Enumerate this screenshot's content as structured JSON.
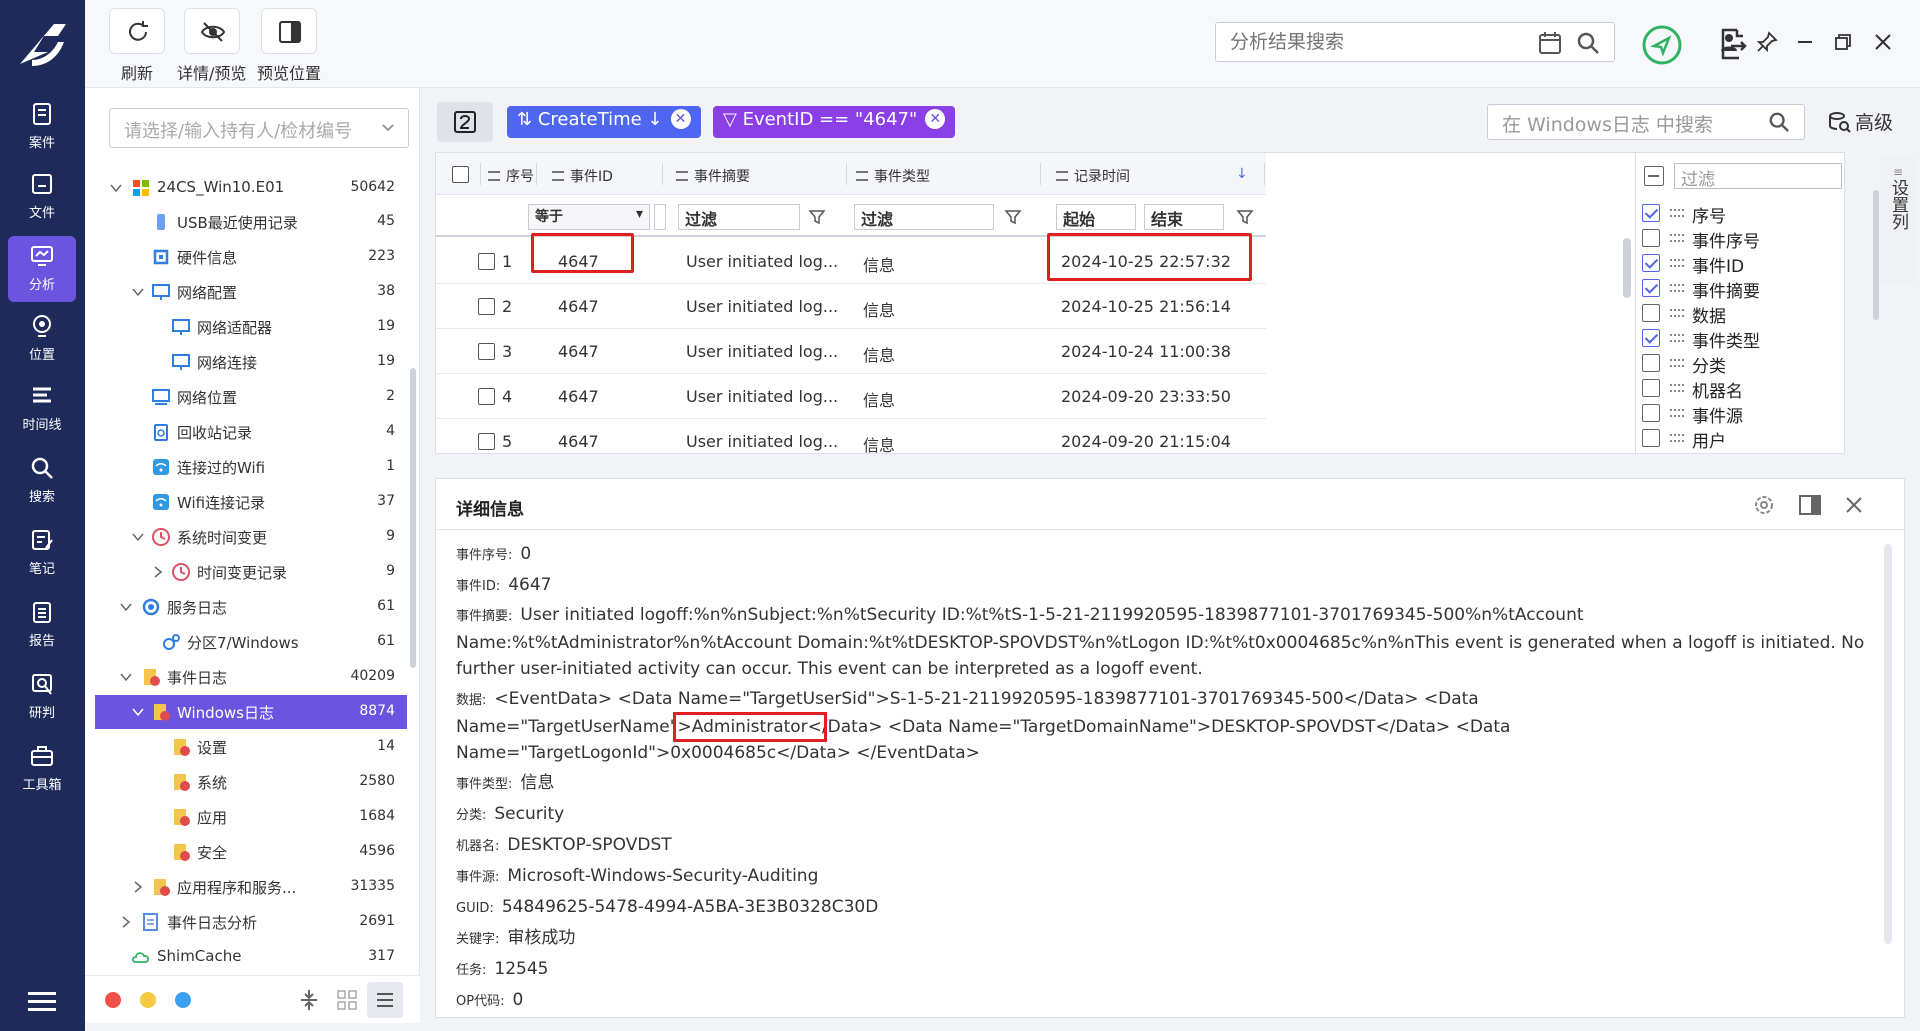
{
  "nav": [
    {
      "label": "案件",
      "icon": "case-icon"
    },
    {
      "label": "文件",
      "icon": "folder-icon"
    },
    {
      "label": "分析",
      "icon": "analysis-icon"
    },
    {
      "label": "位置",
      "icon": "location-icon"
    },
    {
      "label": "时间线",
      "icon": "timeline-icon"
    },
    {
      "label": "搜索",
      "icon": "search-icon"
    },
    {
      "label": "笔记",
      "icon": "note-icon"
    },
    {
      "label": "报告",
      "icon": "report-icon"
    },
    {
      "label": "研判",
      "icon": "judge-icon"
    },
    {
      "label": "工具箱",
      "icon": "toolbox-icon"
    }
  ],
  "toolbar": {
    "refresh": "刷新",
    "detail_preview": "详情/预览",
    "preview_position": "预览位置",
    "search_placeholder": "分析结果搜索"
  },
  "tree": {
    "select_placeholder": "请选择/输入持有人/检材编号",
    "rows": [
      {
        "name": "24CS_Win10.E01",
        "count": "50642"
      },
      {
        "name": "USB最近使用记录",
        "count": "45"
      },
      {
        "name": "硬件信息",
        "count": "223"
      },
      {
        "name": "网络配置",
        "count": "38"
      },
      {
        "name": "网络适配器",
        "count": "19"
      },
      {
        "name": "网络连接",
        "count": "19"
      },
      {
        "name": "网络位置",
        "count": "2"
      },
      {
        "name": "回收站记录",
        "count": "4"
      },
      {
        "name": "连接过的Wifi",
        "count": "1"
      },
      {
        "name": "Wifi连接记录",
        "count": "37"
      },
      {
        "name": "系统时间变更",
        "count": "9"
      },
      {
        "name": "时间变更记录",
        "count": "9"
      },
      {
        "name": "服务日志",
        "count": "61"
      },
      {
        "name": "分区7/Windows",
        "count": "61"
      },
      {
        "name": "事件日志",
        "count": "40209"
      },
      {
        "name": "Windows日志",
        "count": "8874"
      },
      {
        "name": "设置",
        "count": "14"
      },
      {
        "name": "系统",
        "count": "2580"
      },
      {
        "name": "应用",
        "count": "1684"
      },
      {
        "name": "安全",
        "count": "4596"
      },
      {
        "name": "应用程序和服务...",
        "count": "31335"
      },
      {
        "name": "事件日志分析",
        "count": "2691"
      },
      {
        "name": "ShimCache",
        "count": "317"
      }
    ]
  },
  "filters": {
    "sort_chip": "CreateTime",
    "event_chip": "EventID == \"4647\"",
    "win_search_placeholder": "在 Windows日志 中搜索",
    "advanced": "高级"
  },
  "grid": {
    "headers": {
      "seq": "序号",
      "event_id": "事件ID",
      "summary": "事件摘要",
      "type": "事件类型",
      "time": "记录时间"
    },
    "filter_row": {
      "op": "等于",
      "filter1": "过滤",
      "filter2": "过滤",
      "start": "起始",
      "end": "结束"
    },
    "rows": [
      {
        "seq": "1",
        "event_id": "4647",
        "summary": "User initiated log...",
        "type": "信息",
        "time": "2024-10-25 22:57:32"
      },
      {
        "seq": "2",
        "event_id": "4647",
        "summary": "User initiated log...",
        "type": "信息",
        "time": "2024-10-25 21:56:14"
      },
      {
        "seq": "3",
        "event_id": "4647",
        "summary": "User initiated log...",
        "type": "信息",
        "time": "2024-10-24 11:00:38"
      },
      {
        "seq": "4",
        "event_id": "4647",
        "summary": "User initiated log...",
        "type": "信息",
        "time": "2024-09-20 23:33:50"
      },
      {
        "seq": "5",
        "event_id": "4647",
        "summary": "User initiated log...",
        "type": "信息",
        "time": "2024-09-20 21:15:04"
      }
    ]
  },
  "columns": {
    "filter_placeholder": "过滤",
    "items": [
      {
        "name": "序号",
        "checked": true
      },
      {
        "name": "事件序号",
        "checked": false
      },
      {
        "name": "事件ID",
        "checked": true
      },
      {
        "name": "事件摘要",
        "checked": true
      },
      {
        "name": "数据",
        "checked": false
      },
      {
        "name": "事件类型",
        "checked": true
      },
      {
        "name": "分类",
        "checked": false
      },
      {
        "name": "机器名",
        "checked": false
      },
      {
        "name": "事件源",
        "checked": false
      },
      {
        "name": "用户",
        "checked": false
      }
    ],
    "side_tab": "设置列"
  },
  "detail": {
    "title": "详细信息",
    "seq_k": "事件序号:",
    "seq_v": "0",
    "id_k": "事件ID:",
    "id_v": "4647",
    "summary_k": "事件摘要:",
    "summary_v": "User initiated logoff:%n%nSubject:%n%tSecurity ID:%t%tS-1-5-21-2119920595-1839877101-3701769345-500%n%tAccount Name:%t%tAdministrator%n%tAccount Domain:%t%tDESKTOP-SPOVDST%n%tLogon ID:%t%t0x0004685c%n%nThis event is generated when a logoff is initiated. No further user-initiated activity can occur. This event can be interpreted as a logoff event.",
    "data_k": "数据:",
    "data_v1": "<EventData> <Data Name=\"TargetUserSid\">S-1-5-21-2119920595-1839877101-3701769345-500</Data> <Data",
    "data_v2a": "Name=\"TargetUserName\"",
    "data_v2b": ">Administrator<",
    "data_v2c": "/Data> <Data Name=\"TargetDomainName\">DESKTOP-SPOVDST</Data> <Data",
    "data_v3": "Name=\"TargetLogonId\">0x0004685c</Data> </EventData>",
    "type_k": "事件类型:",
    "type_v": "信息",
    "cat_k": "分类:",
    "cat_v": "Security",
    "machine_k": "机器名:",
    "machine_v": "DESKTOP-SPOVDST",
    "source_k": "事件源:",
    "source_v": "Microsoft-Windows-Security-Auditing",
    "guid_k": "GUID:",
    "guid_v": "54849625-5478-4994-A5BA-3E3B0328C30D",
    "kw_k": "关键字:",
    "kw_v": "审核成功",
    "task_k": "任务:",
    "task_v": "12545",
    "op_k": "OP代码:",
    "op_v": "0"
  },
  "colors": {
    "nav_bg": "#1e2a5a",
    "accent": "#6a54e0",
    "chip_blue": "#4f66f0",
    "chip_purple": "#8b3fe6",
    "highlight_red": "#e02020"
  }
}
